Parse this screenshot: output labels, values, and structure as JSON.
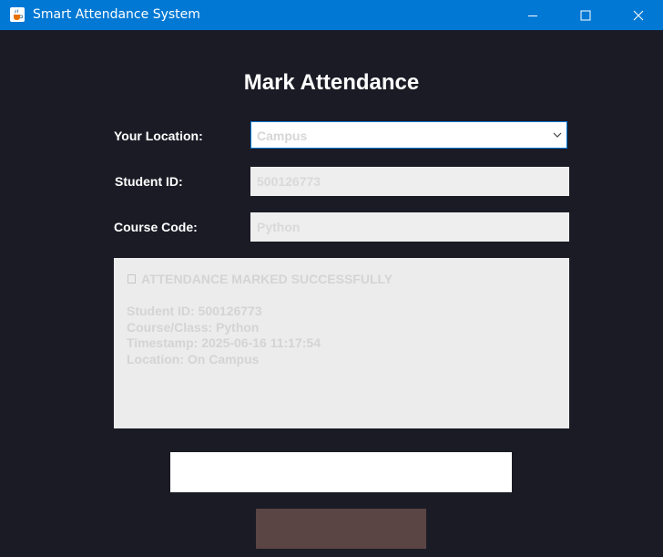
{
  "window": {
    "title": "Smart Attendance System",
    "app_icon": "java-cup-icon",
    "controls": [
      "minimize-icon",
      "maximize-icon",
      "close-icon"
    ]
  },
  "form": {
    "heading": "Mark Attendance",
    "location_label": "Your Location:",
    "location_value": "Campus",
    "student_id_label": "Student ID:",
    "student_id_value": "500126773",
    "course_code_label": "Course Code:",
    "course_code_value": "Python"
  },
  "result": {
    "headline": "ATTENDANCE MARKED SUCCESSFULLY",
    "line_student": "Student ID: 500126773",
    "line_course": "Course/Class: Python",
    "line_timestamp": "Timestamp: 2025-06-16 11:17:54",
    "line_location": "Location: On Campus"
  },
  "colors": {
    "titlebar": "#0078d4",
    "background": "#1b1b26",
    "primary_button": "#ffffff",
    "secondary_button": "#5a4444"
  }
}
